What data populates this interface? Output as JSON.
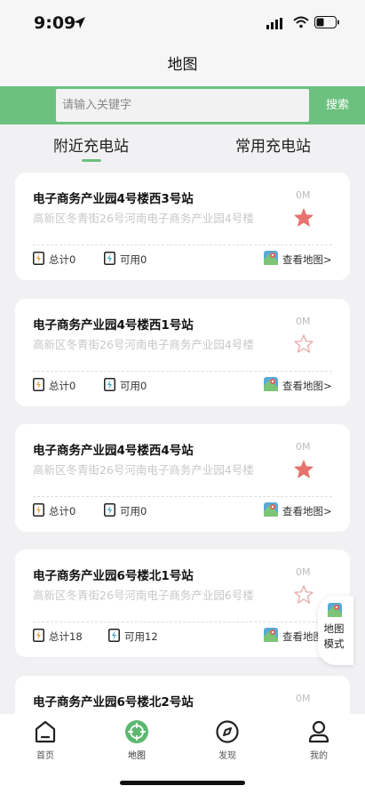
{
  "status_bar": {
    "time": "9:09"
  },
  "header": {
    "title": "地图"
  },
  "search": {
    "placeholder": "请输入关键字",
    "button_label": "搜索"
  },
  "tabs": [
    {
      "label": "附近充电站",
      "active": true
    },
    {
      "label": "常用充电站",
      "active": false
    }
  ],
  "stations": [
    {
      "name": "电子商务产业园4号楼西3号站",
      "distance": "0M",
      "address": "高新区冬青街26号河南电子商务产业园4号楼",
      "favorite": true,
      "total": "总计0",
      "available": "可用0",
      "map_link": "查看地图>"
    },
    {
      "name": "电子商务产业园4号楼西1号站",
      "distance": "0M",
      "address": "高新区冬青街26号河南电子商务产业园4号楼",
      "favorite": false,
      "total": "总计0",
      "available": "可用0",
      "map_link": "查看地图>"
    },
    {
      "name": "电子商务产业园4号楼西4号站",
      "distance": "0M",
      "address": "高新区冬青街26号河南电子商务产业园4号楼",
      "favorite": true,
      "total": "总计0",
      "available": "可用0",
      "map_link": "查看地图>"
    },
    {
      "name": "电子商务产业园6号楼北1号站",
      "distance": "0M",
      "address": "高新区冬青街26号河南电子商务产业园6号楼",
      "favorite": false,
      "total": "总计18",
      "available": "可用12",
      "map_link": "查看地图>"
    },
    {
      "name": "电子商务产业园6号楼北2号站",
      "distance": "0M",
      "address": "",
      "favorite": false,
      "total": "",
      "available": "",
      "map_link": ""
    }
  ],
  "map_mode": {
    "label": "地图模式"
  },
  "bottom_tabs": [
    {
      "label": "首页",
      "icon": "home-icon"
    },
    {
      "label": "地图",
      "icon": "map-target-icon",
      "active": true
    },
    {
      "label": "发现",
      "icon": "compass-icon"
    },
    {
      "label": "我的",
      "icon": "profile-icon"
    }
  ],
  "colors": {
    "accent": "#6cc17f",
    "star_active": "#e8736e",
    "star_inactive": "#e8a7a4"
  }
}
